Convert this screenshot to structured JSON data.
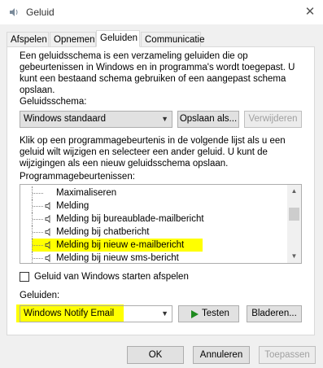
{
  "window": {
    "title": "Geluid",
    "close_glyph": "✕"
  },
  "tabs": [
    {
      "label": "Afspelen"
    },
    {
      "label": "Opnemen"
    },
    {
      "label": "Geluiden"
    },
    {
      "label": "Communicatie"
    }
  ],
  "intro": {
    "line1": "Een geluidsschema is een verzameling geluiden die op",
    "line2": "gebeurtenissen in Windows en in programma's wordt toegepast.  U",
    "line3": "kunt een bestaand schema gebruiken of een aangepast schema",
    "line4": "opslaan."
  },
  "scheme": {
    "label": "Geluidsschema:",
    "value": "Windows standaard",
    "save_button": "Opslaan als...",
    "delete_button": "Verwijderen"
  },
  "instructions": {
    "line1": "Klik op een programmagebeurtenis in de volgende lijst als u een",
    "line2": "geluid wilt wijzigen en selecteer een ander geluid. U kunt de",
    "line3": "wijzigingen als een nieuw geluidsschema opslaan."
  },
  "events": {
    "label": "Programmagebeurtenissen:",
    "items": [
      {
        "label": "Maximaliseren",
        "has_sound": false
      },
      {
        "label": "Melding",
        "has_sound": true
      },
      {
        "label": "Melding bij bureaublade-mailbericht",
        "has_sound": true
      },
      {
        "label": "Melding bij chatbericht",
        "has_sound": true
      },
      {
        "label": "Melding bij nieuw e-mailbericht",
        "has_sound": true,
        "highlighted": true
      },
      {
        "label": "Melding bij nieuw sms-bericht",
        "has_sound": true
      }
    ]
  },
  "startup_checkbox": {
    "label": "Geluid van Windows starten afspelen",
    "checked": false
  },
  "sounds": {
    "label": "Geluiden:",
    "value": "Windows Notify Email",
    "test_button": "Testen",
    "browse_button": "Bladeren..."
  },
  "footer": {
    "ok": "OK",
    "cancel": "Annuleren",
    "apply": "Toepassen"
  },
  "colors": {
    "highlight": "#ffff00",
    "panel": "#ffffff",
    "dialog": "#f0f0f0",
    "play_icon": "#1e8a1e"
  }
}
